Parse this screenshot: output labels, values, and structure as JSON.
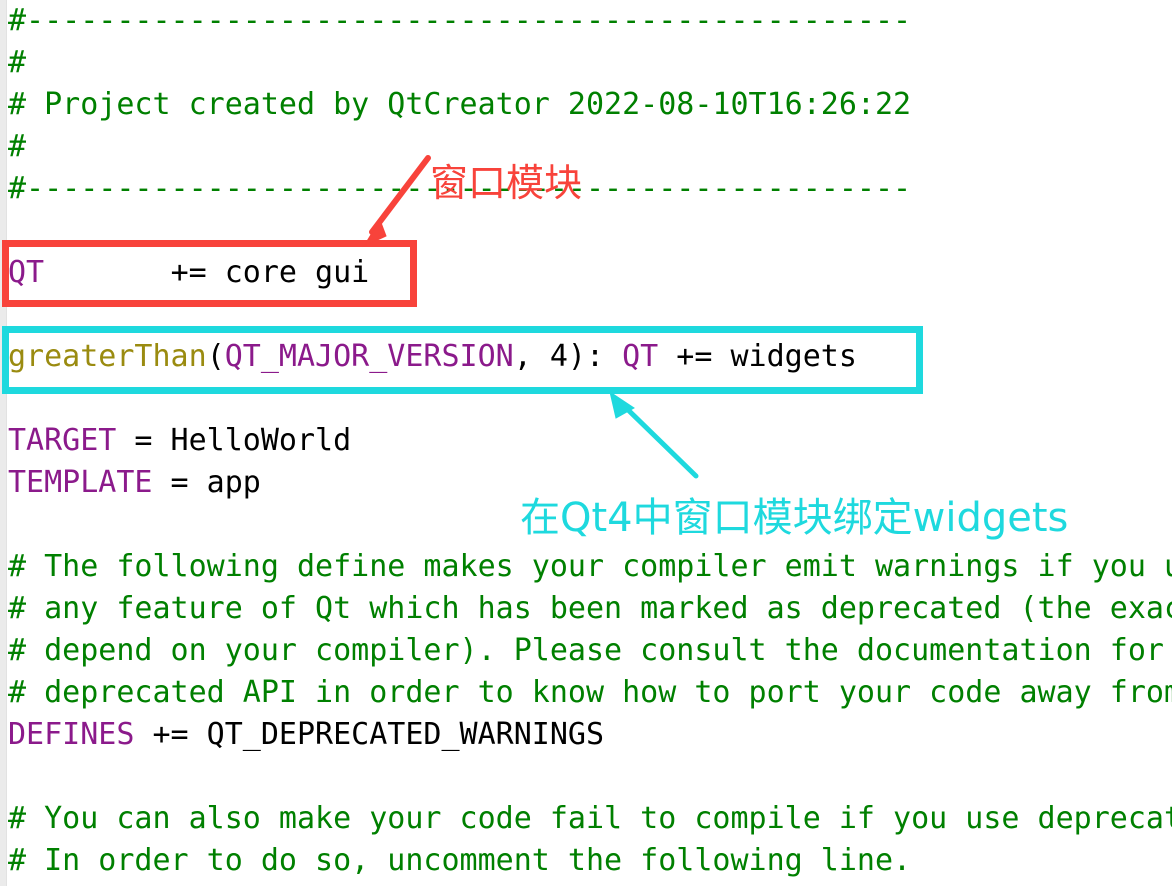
{
  "editor": {
    "filetype": "qmake-project",
    "gutter_color": "#ebebeb",
    "background": "#ffffff",
    "comment_color": "#008000",
    "keyword_color": "#8b1a8b",
    "function_color": "#9a8b10",
    "text_color": "#000000"
  },
  "lines": {
    "l1_comment": "#-------------------------------------------------",
    "l2_comment": "#",
    "l3_comment": "# Project created by QtCreator 2022-08-10T16:26:22",
    "l4_comment": "#",
    "l5_comment": "#-------------------------------------------------",
    "qt_keyword": "QT",
    "qt_spacer": "       ",
    "qt_operator": "+=",
    "qt_value": " core gui",
    "gt_function": "greaterThan",
    "gt_open": "(",
    "gt_arg": "QT_MAJOR_VERSION",
    "gt_mid": ", 4): ",
    "gt_qt": "QT",
    "gt_tail": " += widgets",
    "target_keyword": "TARGET",
    "target_value": " = HelloWorld",
    "template_keyword": "TEMPLATE",
    "template_value": " = app",
    "c1": "# The following define makes your compiler emit warnings if you use",
    "c2": "# any feature of Qt which has been marked as deprecated (the exact warnings",
    "c3": "# depend on your compiler). Please consult the documentation for the",
    "c4": "# deprecated API in order to know how to port your code away from it.",
    "defines_keyword": "DEFINES",
    "defines_value": " += QT_DEPRECATED_WARNINGS",
    "c5": "# You can also make your code fail to compile if you use deprecated APIs.",
    "c6": "# In order to do so, uncomment the following line."
  },
  "annotations": {
    "red": {
      "label": "窗口模块",
      "color": "#f8433b",
      "target": "QT += core gui",
      "box_border_px": 7
    },
    "cyan": {
      "label": "在Qt4中窗口模块绑定widgets",
      "color": "#1ed9de",
      "target": "greaterThan(QT_MAJOR_VERSION, 4): QT += widgets",
      "box_border_px": 7
    }
  }
}
